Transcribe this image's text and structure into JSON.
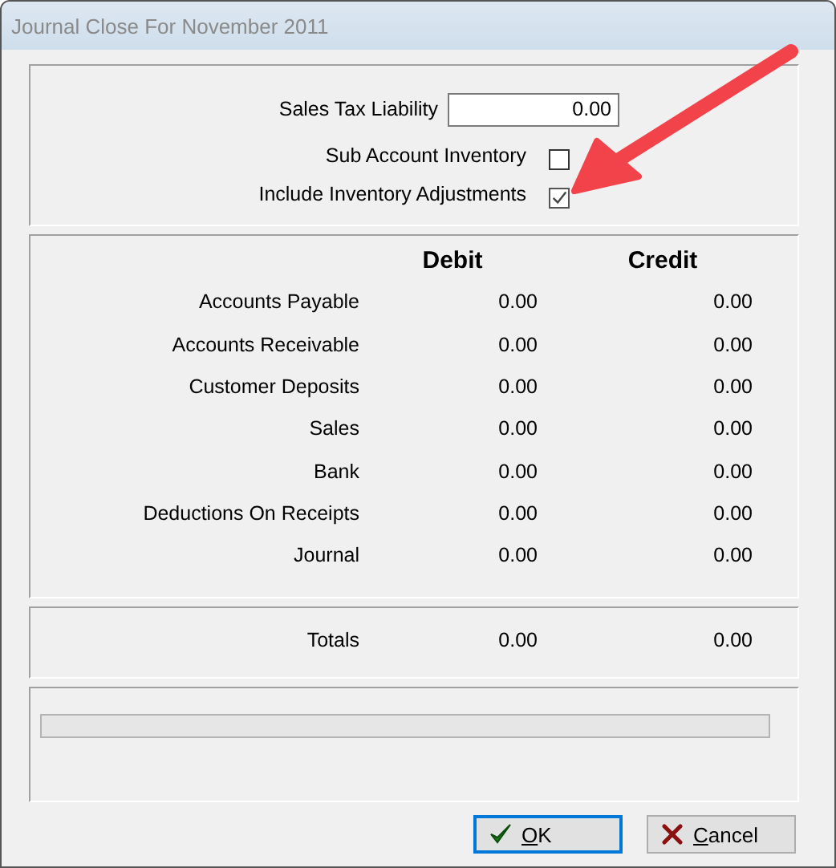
{
  "window": {
    "title": "Journal Close For November 2011"
  },
  "options": {
    "sales_tax_liability": {
      "label": "Sales Tax Liability",
      "value": "0.00"
    },
    "checkboxes": [
      {
        "label": "Sub Account Inventory",
        "checked": false
      },
      {
        "label": "Include Inventory Adjustments",
        "checked": true
      }
    ]
  },
  "table": {
    "columns": [
      "Debit",
      "Credit"
    ],
    "rows": [
      {
        "account": "Accounts Payable",
        "debit": "0.00",
        "credit": "0.00"
      },
      {
        "account": "Accounts Receivable",
        "debit": "0.00",
        "credit": "0.00"
      },
      {
        "account": "Customer Deposits",
        "debit": "0.00",
        "credit": "0.00"
      },
      {
        "account": "Sales",
        "debit": "0.00",
        "credit": "0.00"
      },
      {
        "account": "Bank",
        "debit": "0.00",
        "credit": "0.00"
      },
      {
        "account": "Deductions On Receipts",
        "debit": "0.00",
        "credit": "0.00"
      },
      {
        "account": "Journal",
        "debit": "0.00",
        "credit": "0.00"
      }
    ],
    "totals": {
      "label": "Totals",
      "debit": "0.00",
      "credit": "0.00"
    }
  },
  "progress": {
    "level": 0
  },
  "buttons": [
    {
      "label": "OK",
      "kind": "ok",
      "focused": true
    },
    {
      "label": "Cancel",
      "kind": "cancel",
      "focused": false
    }
  ]
}
